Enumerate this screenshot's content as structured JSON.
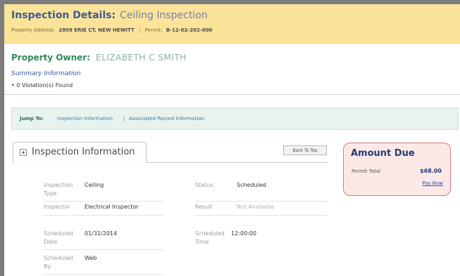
{
  "header": {
    "title": "Inspection Details:",
    "subtitle": "Ceiling Inspection",
    "address_label": "Property Address:",
    "address_value": "2809 ERIE CT, NEW HEWITT",
    "permit_label": "Permit:",
    "permit_value": "B-12-02-202-000"
  },
  "owner": {
    "label": "Property Owner:",
    "name": "ELIZABETH C SMITH"
  },
  "summary": {
    "link": "Summary Information",
    "item": "• 0 Violation(s) Found"
  },
  "jump": {
    "label": "Jump To:",
    "link_inspection": "Inspection Information",
    "separator": "|",
    "link_associated": "Associated Record Information"
  },
  "section": {
    "tab_label": "Inspection Information",
    "back_to_top": "Back To Top"
  },
  "details": {
    "inspection_type_label": "Inspection Type",
    "inspection_type_value": "Ceiling",
    "status_label": "Status",
    "status_value": "Scheduled",
    "inspector_label": "Inspector",
    "inspector_value": "Electrical Inspector",
    "result_label": "Result",
    "result_value": "Not Available",
    "scheduled_date_label": "Scheduled Date",
    "scheduled_date_value": "01/31/2014",
    "scheduled_time_label": "Scheduled Time",
    "scheduled_time_value": "12:00:00",
    "scheduled_by_label": "Scheduled By",
    "scheduled_by_value": "Web"
  },
  "amount_due": {
    "title": "Amount Due",
    "permit_total_label": "Permit Total",
    "permit_total_value": "$68.00",
    "pay_now": "Pay Now"
  }
}
